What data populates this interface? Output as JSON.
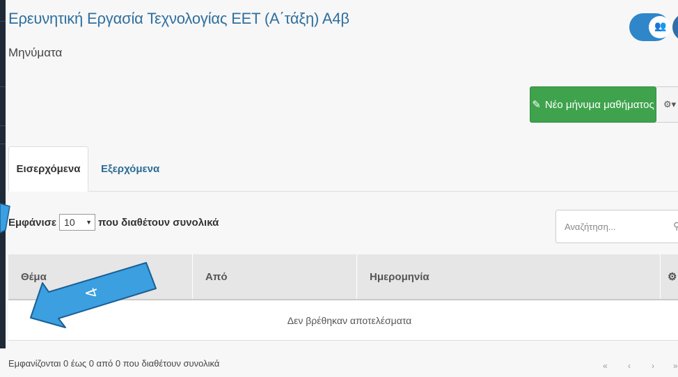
{
  "header": {
    "course_title": "Ερευνητική Εργασία Τεχνολογίας ΕΕΤ (Α΄τάξη) Α4β",
    "page_subtitle": "Μηνύματα"
  },
  "actions": {
    "new_message_label": "Νέο μήνυμα μαθήματος"
  },
  "tabs": [
    {
      "label": "Εισερχόμενα",
      "active": true
    },
    {
      "label": "Εξερχόμενα",
      "active": false
    }
  ],
  "table_controls": {
    "show_prefix": "Εμφάνισε",
    "page_size": "10",
    "show_suffix": "που διαθέτουν συνολικά",
    "search_placeholder": "Αναζήτηση..."
  },
  "table": {
    "columns": [
      "Θέμα",
      "Από",
      "Ημερομηνία"
    ],
    "empty_message": "Δεν βρέθηκαν αποτελέσματα"
  },
  "footer": {
    "info": "Εμφανίζονται 0 έως 0 από 0 που διαθέτουν συνολικά",
    "pager": {
      "first": "«",
      "prev": "‹",
      "next": "›",
      "last": "»"
    }
  },
  "annotation": {
    "number": "4",
    "color": "#3b9fe0"
  },
  "colors": {
    "accent": "#2e6f9e",
    "success": "#3fa34d",
    "toggle": "#2f86c9"
  }
}
